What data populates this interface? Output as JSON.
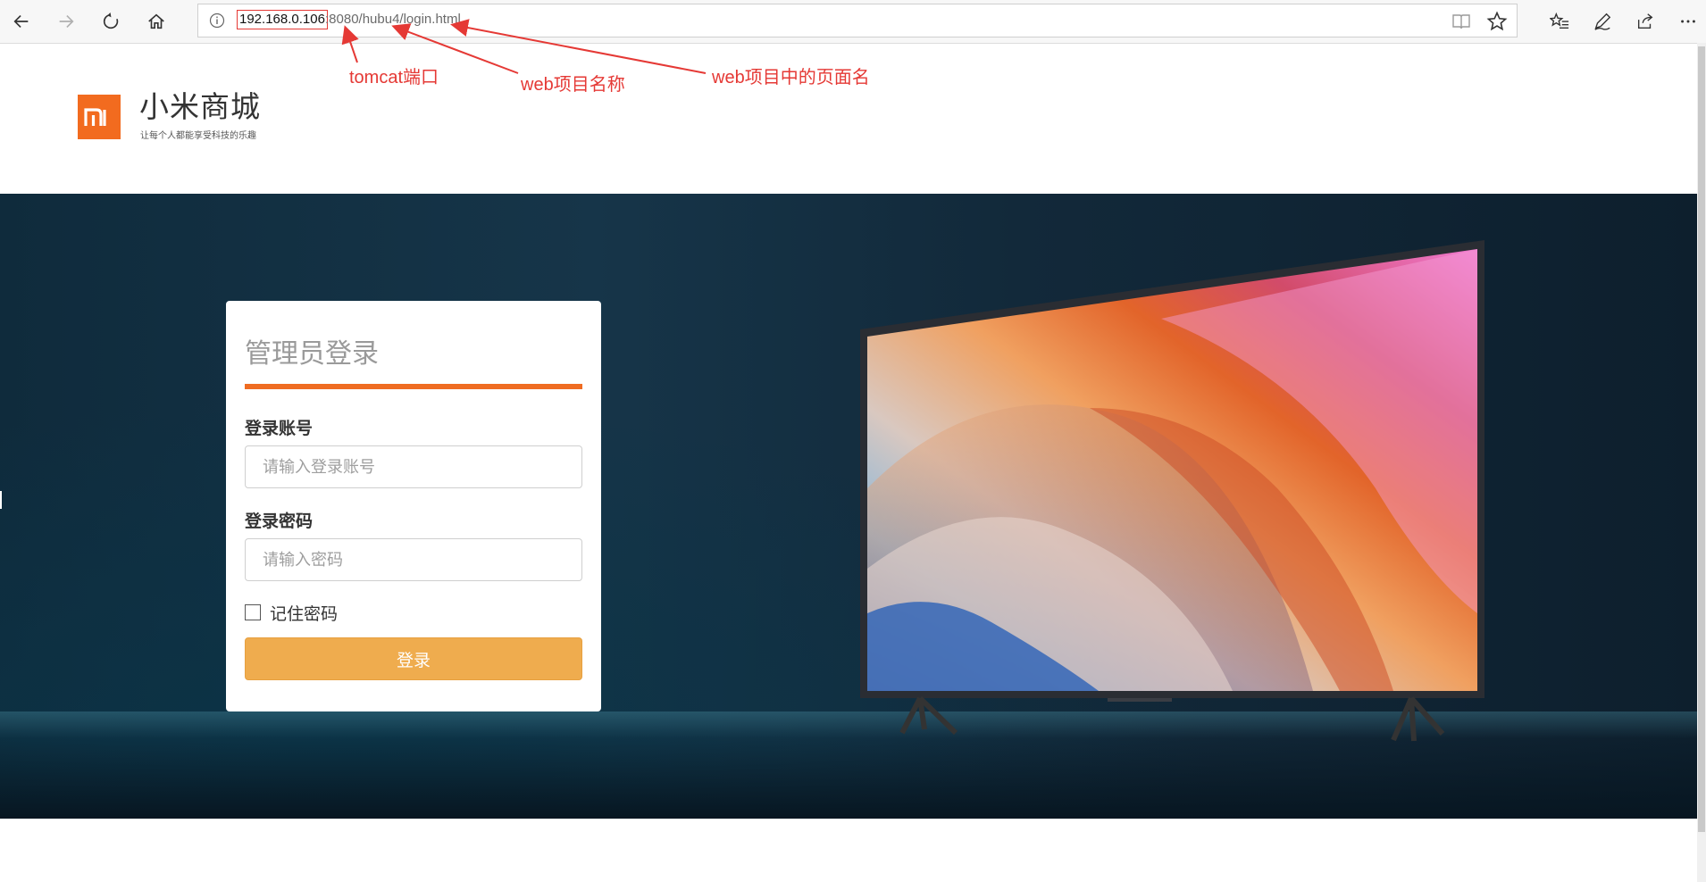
{
  "browser": {
    "url_host": "192.168.0.106",
    "url_rest": ":8080/hubu4/login.html",
    "icons": {
      "back": "back-arrow-icon",
      "forward": "forward-arrow-icon",
      "refresh": "refresh-icon",
      "home": "home-icon",
      "info": "info-icon",
      "reading": "reading-view-icon",
      "favorite": "star-icon",
      "favorites_list": "favorites-list-icon",
      "pen": "pen-icon",
      "share": "share-icon",
      "more": "more-icon"
    }
  },
  "annotations": {
    "port": "tomcat端口",
    "project": "web项目名称",
    "page": "web项目中的页面名",
    "color": "#e53935"
  },
  "site": {
    "brand_name": "小米商城",
    "slogan": "让每个人都能享受科技的乐趣",
    "logo_color": "#f26b1f"
  },
  "login": {
    "title": "管理员登录",
    "account_label": "登录账号",
    "account_placeholder": "请输入登录账号",
    "password_label": "登录密码",
    "password_placeholder": "请输入密码",
    "remember_label": "记住密码",
    "submit_label": "登录",
    "accent_color": "#ef6c22",
    "button_color": "#efac4e"
  }
}
